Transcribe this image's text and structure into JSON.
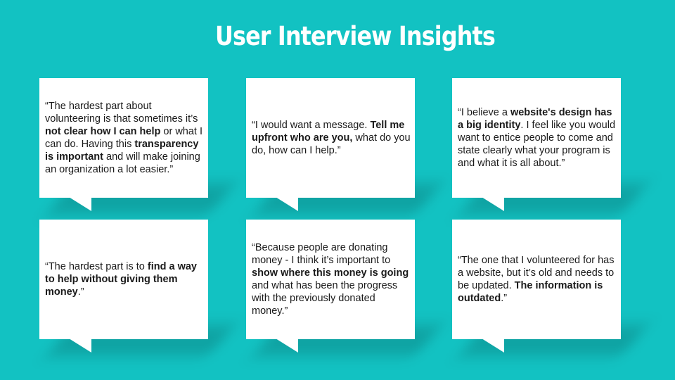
{
  "title": "User Interview Insights",
  "colors": {
    "background": "#12c2c2",
    "card": "#ffffff",
    "text": "#1a1a1a"
  },
  "quotes": [
    {
      "segments": [
        {
          "text": "“The hardest part about volunteering is that sometimes it’s ",
          "bold": false
        },
        {
          "text": "not clear how I can help",
          "bold": true
        },
        {
          "text": " or what I can do. Having this ",
          "bold": false
        },
        {
          "text": "transparency is important",
          "bold": true
        },
        {
          "text": " and will make joining an organization a lot easier.”",
          "bold": false
        }
      ]
    },
    {
      "segments": [
        {
          "text": "“I would want a message. ",
          "bold": false
        },
        {
          "text": "Tell me upfront who are you,",
          "bold": true
        },
        {
          "text": " what do you do, how can I help.”",
          "bold": false
        }
      ]
    },
    {
      "segments": [
        {
          "text": "“I believe a ",
          "bold": false
        },
        {
          "text": "website's design has a big identity",
          "bold": true
        },
        {
          "text": ". I feel like you would want to entice people to come and state clearly what your program is and what it is all about.”",
          "bold": false
        }
      ]
    },
    {
      "segments": [
        {
          "text": "“The hardest part is to ",
          "bold": false
        },
        {
          "text": "find a way to help without giving them money",
          "bold": true
        },
        {
          "text": ".”",
          "bold": false
        }
      ]
    },
    {
      "segments": [
        {
          "text": "“Because people are donating money - I think it’s important to ",
          "bold": false
        },
        {
          "text": "show where this money is going",
          "bold": true
        },
        {
          "text": " and what has been the progress with the previously donated money.”",
          "bold": false
        }
      ]
    },
    {
      "segments": [
        {
          "text": "“The one that I volunteered for has a website, but it’s old and needs to be updated. ",
          "bold": false
        },
        {
          "text": "The information is outdated",
          "bold": true
        },
        {
          "text": ".”",
          "bold": false
        }
      ]
    }
  ]
}
